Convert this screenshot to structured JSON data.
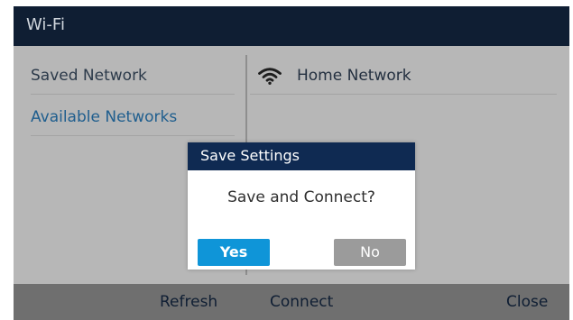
{
  "window": {
    "title": "Wi-Fi"
  },
  "sidebar": {
    "items": [
      {
        "label": "Saved Network"
      },
      {
        "label": "Available Networks"
      }
    ]
  },
  "networks": [
    {
      "name": "Home Network",
      "icon": "wifi-icon"
    }
  ],
  "dialog": {
    "title": "Save Settings",
    "message": "Save and Connect?",
    "yes_label": "Yes",
    "no_label": "No"
  },
  "softkeys": {
    "refresh": "Refresh",
    "connect": "Connect",
    "close": "Close"
  },
  "colors": {
    "title_bar": "#0f1e33",
    "content_bg": "#b7b7b7",
    "dialog_header": "#0f2a52",
    "yes_button": "#0f95d8",
    "no_button": "#9b9b9b",
    "softkey_bar": "#6f6f6f",
    "available_text": "#1f5e8e"
  }
}
